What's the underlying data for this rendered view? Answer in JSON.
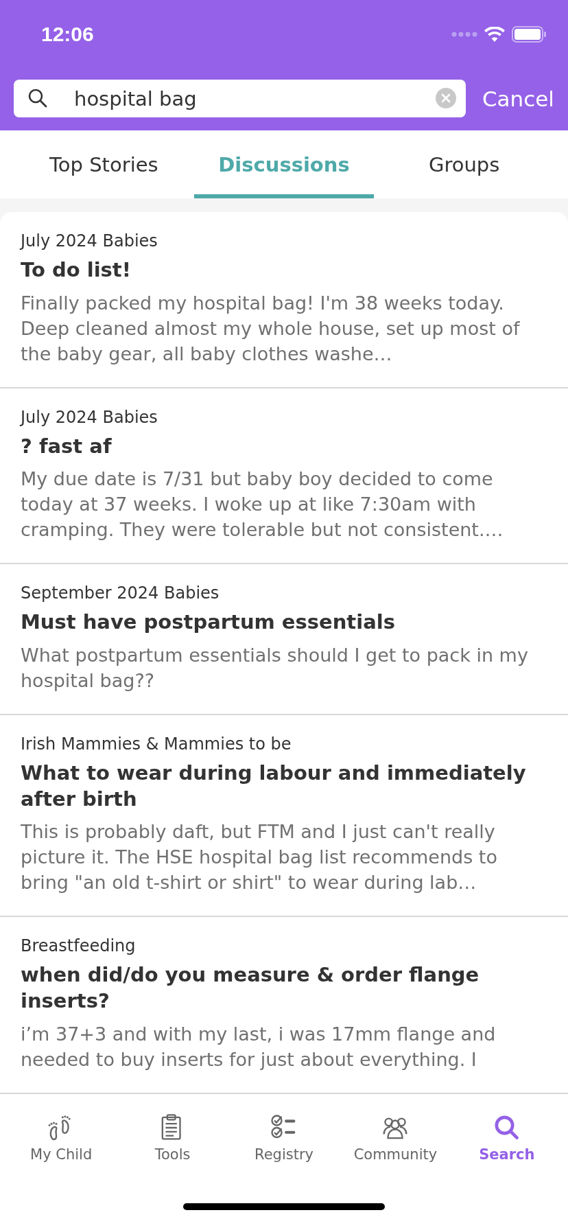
{
  "status_bar": {
    "time": "12:06"
  },
  "search": {
    "value": "hospital bag",
    "cancel": "Cancel"
  },
  "tabs": [
    {
      "label": "Top Stories",
      "selected": false
    },
    {
      "label": "Discussions",
      "selected": true
    },
    {
      "label": "Groups",
      "selected": false
    }
  ],
  "posts": [
    {
      "group": "July 2024 Babies",
      "title": "To do list!",
      "body": "Finally packed my hospital bag! I'm 38 weeks today. Deep cleaned almost my whole house, set up most of the baby gear, all baby clothes washe…"
    },
    {
      "group": "July 2024 Babies",
      "title": "? fast af",
      "body": "My due date is 7/31 but baby boy decided to come today at 37 weeks. I woke up at like 7:30am with cramping. They were tolerable but not consistent.…"
    },
    {
      "group": "September 2024 Babies",
      "title": "Must have postpartum essentials",
      "body": "What postpartum essentials should I get to pack in my hospital bag??"
    },
    {
      "group": "Irish Mammies & Mammies to be",
      "title": "What to wear during labour and immediately after birth",
      "body": "This is probably daft, but FTM and I just can't really picture it. The HSE hospital bag list recommends to bring \"an old t-shirt or shirt\" to wear during lab…"
    },
    {
      "group": "Breastfeeding",
      "title": "when did/do you measure & order flange inserts?",
      "body": "i’m 37+3 and with my last, i was 17mm flange and needed to buy inserts for just about everything. I"
    }
  ],
  "nav": [
    {
      "label": "My Child",
      "kind": "feet",
      "selected": false
    },
    {
      "label": "Tools",
      "kind": "clipboard",
      "selected": false
    },
    {
      "label": "Registry",
      "kind": "checklist",
      "selected": false
    },
    {
      "label": "Community",
      "kind": "people",
      "selected": false
    },
    {
      "label": "Search",
      "kind": "search",
      "selected": true
    }
  ]
}
